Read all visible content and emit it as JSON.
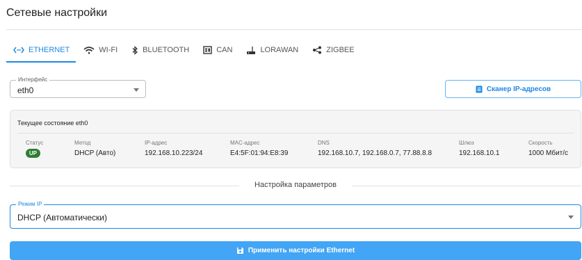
{
  "page": {
    "title": "Сетевые настройки"
  },
  "tabs": [
    {
      "label": "Ethernet",
      "icon": "ethernet-icon"
    },
    {
      "label": "Wi-Fi",
      "icon": "wifi-icon"
    },
    {
      "label": "Bluetooth",
      "icon": "bluetooth-icon"
    },
    {
      "label": "CAN",
      "icon": "can-bus-icon"
    },
    {
      "label": "LoRaWAN",
      "icon": "router-icon"
    },
    {
      "label": "Zigbee",
      "icon": "share-icon"
    }
  ],
  "interface": {
    "legend": "Интерфейс",
    "value": "eth0"
  },
  "scanner": {
    "label": "Сканер IP-адресов",
    "icon": "list-icon"
  },
  "status": {
    "title": "Текущее состояние eth0",
    "columns": {
      "status": {
        "label": "Статус",
        "value": "UP"
      },
      "method": {
        "label": "Метод",
        "value": "DHCP (Авто)"
      },
      "ip": {
        "label": "IP-адрес",
        "value": "192.168.10.223/24"
      },
      "mac": {
        "label": "MAC-адрес",
        "value": "E4:5F:01:94:E8:39"
      },
      "dns": {
        "label": "DNS",
        "value": "192.168.10.7, 192.168.0.7, 77.88.8.8"
      },
      "gateway": {
        "label": "Шлюз",
        "value": "192.168.10.1"
      },
      "speed": {
        "label": "Скорость",
        "value": "1000 Мбит/с"
      }
    }
  },
  "settings": {
    "divider": "Настройка параметров"
  },
  "ip_mode": {
    "legend": "Режим IP",
    "value": "DHCP (Автоматически)"
  },
  "apply": {
    "label": "Применить настройки Ethernet",
    "icon": "save-icon"
  },
  "colors": {
    "accent": "#1e88e5",
    "button": "#42a5f5",
    "up_badge": "#2e7d32"
  }
}
